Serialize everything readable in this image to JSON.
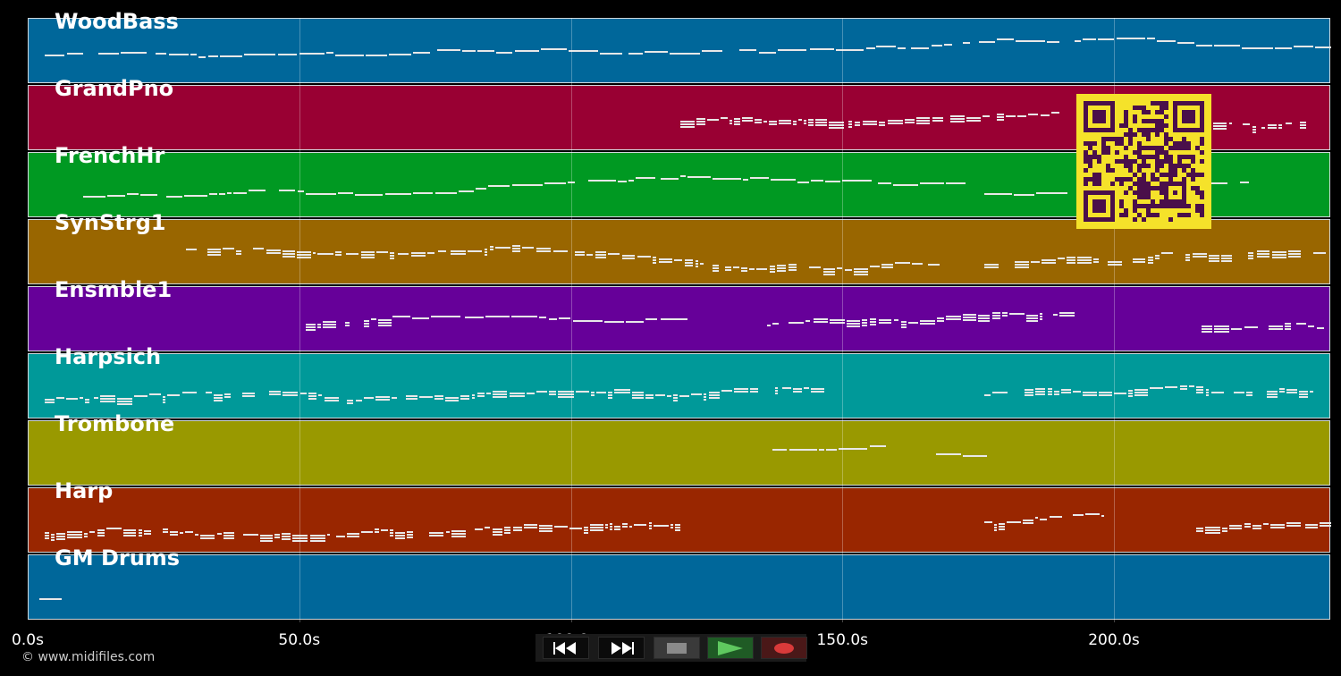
{
  "tracks": [
    {
      "name": "WoodBass",
      "color": "#00679a"
    },
    {
      "name": "GrandPno",
      "color": "#990033"
    },
    {
      "name": "FrenchHr",
      "color": "#009922"
    },
    {
      "name": "SynStrg1",
      "color": "#996600"
    },
    {
      "name": "Ensmble1",
      "color": "#660099"
    },
    {
      "name": "Harpsich",
      "color": "#009999"
    },
    {
      "name": "Trombone",
      "color": "#999900"
    },
    {
      "name": "Harp",
      "color": "#992600"
    },
    {
      "name": "GM Drums",
      "color": "#00679a"
    }
  ],
  "timeline": {
    "max_seconds": 240,
    "ticks": [
      "0.0s",
      "50.0s",
      "100.0s",
      "150.0s",
      "200.0s"
    ],
    "tick_values": [
      0,
      50,
      100,
      150,
      200
    ]
  },
  "copyright": "© www.midifiles.com",
  "transport": {
    "rewind_icon": "rewind-icon",
    "fast_forward_icon": "fast-forward-icon",
    "stop_icon": "stop-icon",
    "play_icon": "play-icon",
    "record_icon": "record-icon",
    "stop_color": "#8a8a8a",
    "play_color": "#5fc85f",
    "record_color": "#d93a3a"
  },
  "qr_code": {
    "icon": "qr-code-icon",
    "background": "#f5e22a",
    "foreground": "#4a0f4a"
  }
}
